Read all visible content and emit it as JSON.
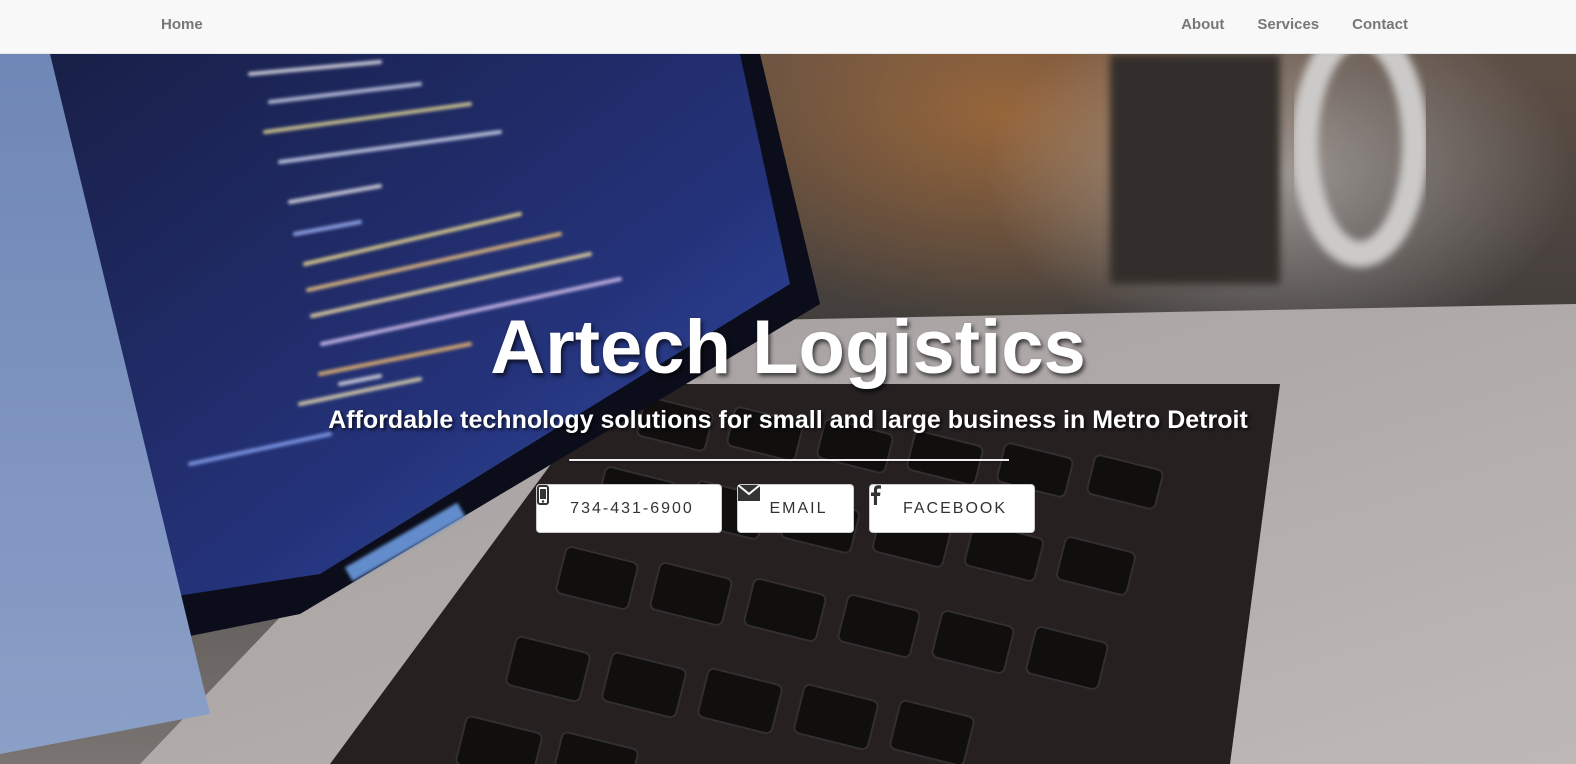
{
  "nav": {
    "home": "Home",
    "links": [
      "About",
      "Services",
      "Contact"
    ]
  },
  "hero": {
    "title": "Artech Logistics",
    "subtitle": "Affordable technology solutions for small and large business in Metro Detroit",
    "background": "photo-laptop-with-code",
    "buttons": {
      "phone": {
        "label": "734-431-6900",
        "icon": "mobile-phone-icon"
      },
      "email": {
        "label": "EMAIL",
        "icon": "envelope-icon"
      },
      "facebook": {
        "label": "FACEBOOK",
        "icon": "facebook-icon"
      }
    }
  },
  "colors": {
    "navbar_bg": "#f8f8f8",
    "nav_text": "#777777",
    "hero_text": "#ffffff",
    "button_bg": "#ffffff",
    "button_text": "#333333"
  }
}
